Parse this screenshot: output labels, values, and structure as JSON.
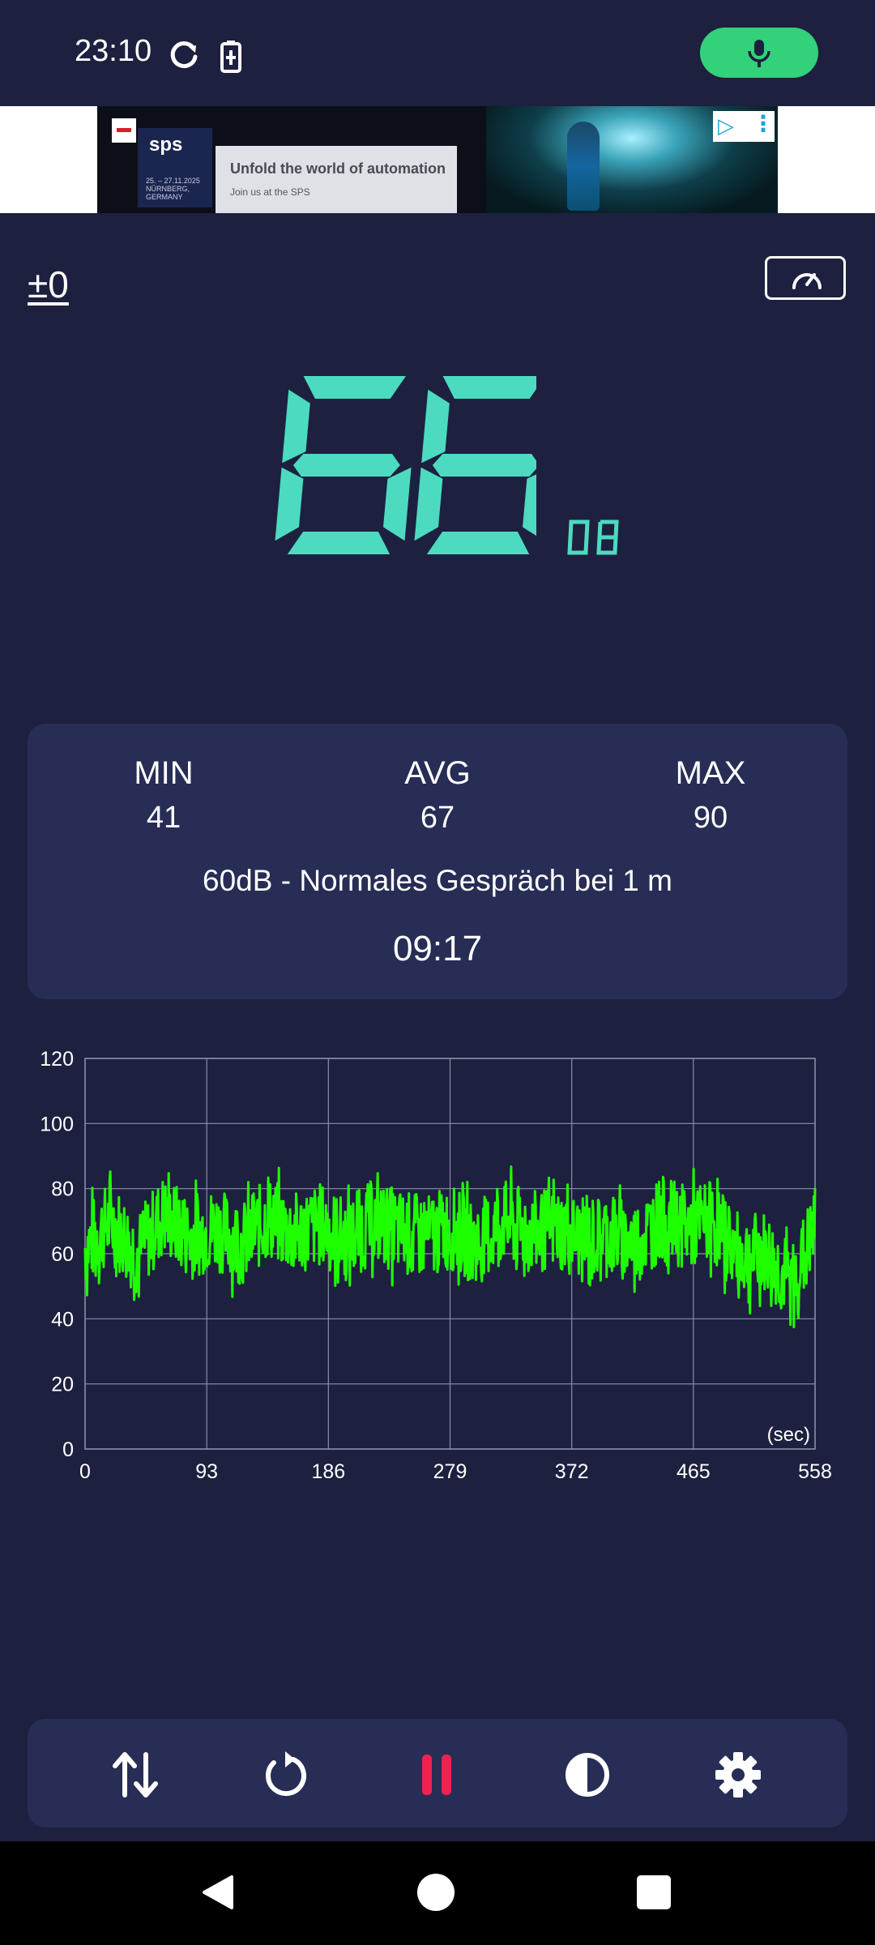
{
  "status_bar": {
    "time": "23:10",
    "icons": [
      "sync-icon",
      "battery-charging-icon"
    ],
    "mic_indicator_color": "#33d17a"
  },
  "ad": {
    "logo_text": "sps",
    "logo_date": "25. – 27.11.2025 NÜRNBERG, GERMANY",
    "headline": "Unfold the world of automation",
    "subline": "Join us at the SPS"
  },
  "meter": {
    "calibration": "±0",
    "reading": "66",
    "unit": "DB",
    "digit_color": "#4cdbc0"
  },
  "stats": {
    "min_label": "MIN",
    "min_value": "41",
    "avg_label": "AVG",
    "avg_value": "67",
    "max_label": "MAX",
    "max_value": "90",
    "description": "60dB - Normales Gespräch bei 1 m",
    "elapsed": "09:17"
  },
  "chart_data": {
    "type": "line",
    "x_ticks": [
      "0",
      "93",
      "186",
      "279",
      "372",
      "465",
      "558"
    ],
    "y_ticks": [
      "0",
      "20",
      "40",
      "60",
      "80",
      "100",
      "120"
    ],
    "xlim": [
      0,
      558
    ],
    "ylim": [
      0,
      120
    ],
    "x_unit": "(sec)",
    "grid": true,
    "line_color": "#1eff00",
    "series": [
      {
        "x": [
          0,
          20,
          40,
          60,
          80,
          100,
          120,
          140,
          160,
          180,
          200,
          220,
          240,
          260,
          280,
          300,
          320,
          340,
          360,
          380,
          400,
          420,
          440,
          460,
          480,
          500,
          520,
          540,
          558
        ],
        "values": [
          62,
          70,
          60,
          72,
          65,
          68,
          63,
          71,
          66,
          69,
          64,
          70,
          67,
          65,
          68,
          63,
          70,
          66,
          68,
          64,
          66,
          63,
          71,
          68,
          70,
          59,
          60,
          50,
          67
        ]
      }
    ]
  },
  "toolbar": {
    "icons": [
      "swap-icon",
      "reset-icon",
      "pause-icon",
      "contrast-icon",
      "settings-icon"
    ],
    "pause_color": "#f0214f"
  },
  "nav": {
    "icons": [
      "back-icon",
      "home-icon",
      "recents-icon"
    ]
  }
}
